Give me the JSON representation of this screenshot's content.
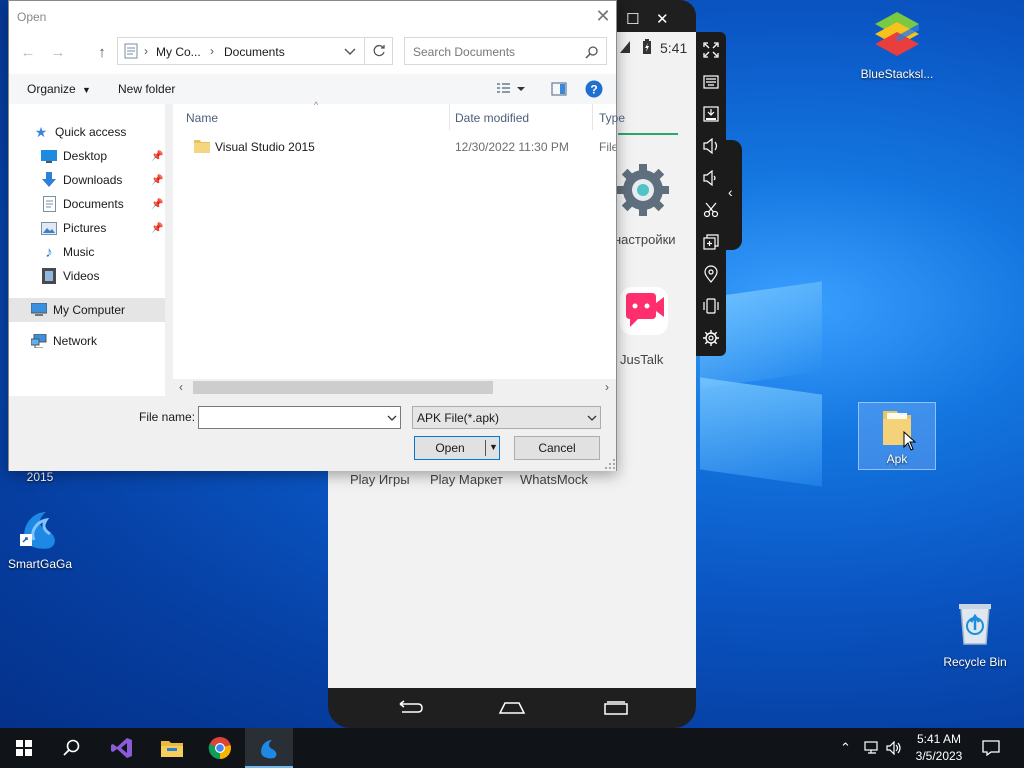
{
  "dialog": {
    "title": "Open",
    "breadcrumb": [
      "My Co...",
      "Documents"
    ],
    "search_placeholder": "Search Documents",
    "toolbar": {
      "organize": "Organize",
      "new_folder": "New folder"
    },
    "nav": {
      "quick_access": "Quick access",
      "items": [
        "Desktop",
        "Downloads",
        "Documents",
        "Pictures",
        "Music",
        "Videos"
      ],
      "my_computer": "My Computer",
      "network": "Network"
    },
    "columns": {
      "name": "Name",
      "date": "Date modified",
      "type": "Type"
    },
    "files": [
      {
        "name": "Visual Studio 2015",
        "date": "12/30/2022 11:30 PM",
        "type": "File fo"
      }
    ],
    "file_name_label": "File name:",
    "file_name_value": "",
    "file_type": "APK File(*.apk)",
    "open_button": "Open",
    "cancel_button": "Cancel"
  },
  "emulator": {
    "time": "5:41",
    "apps": [
      "настройки",
      "JusTalk"
    ],
    "bottom_apps": [
      "Play Игры",
      "Play Маркет",
      "WhatsMock"
    ]
  },
  "desktop": {
    "icons": {
      "bluestacks": "BlueStacksl...",
      "apk": "Apk",
      "recycle": "Recycle Bin",
      "smartgaga": "SmartGaGa",
      "vs_partial": "2015"
    }
  },
  "taskbar": {
    "time": "5:41 AM",
    "date": "3/5/2023"
  },
  "colors": {
    "accent": "#0078d7",
    "desktop": "#0a56c4",
    "taskbar": "#101418"
  }
}
